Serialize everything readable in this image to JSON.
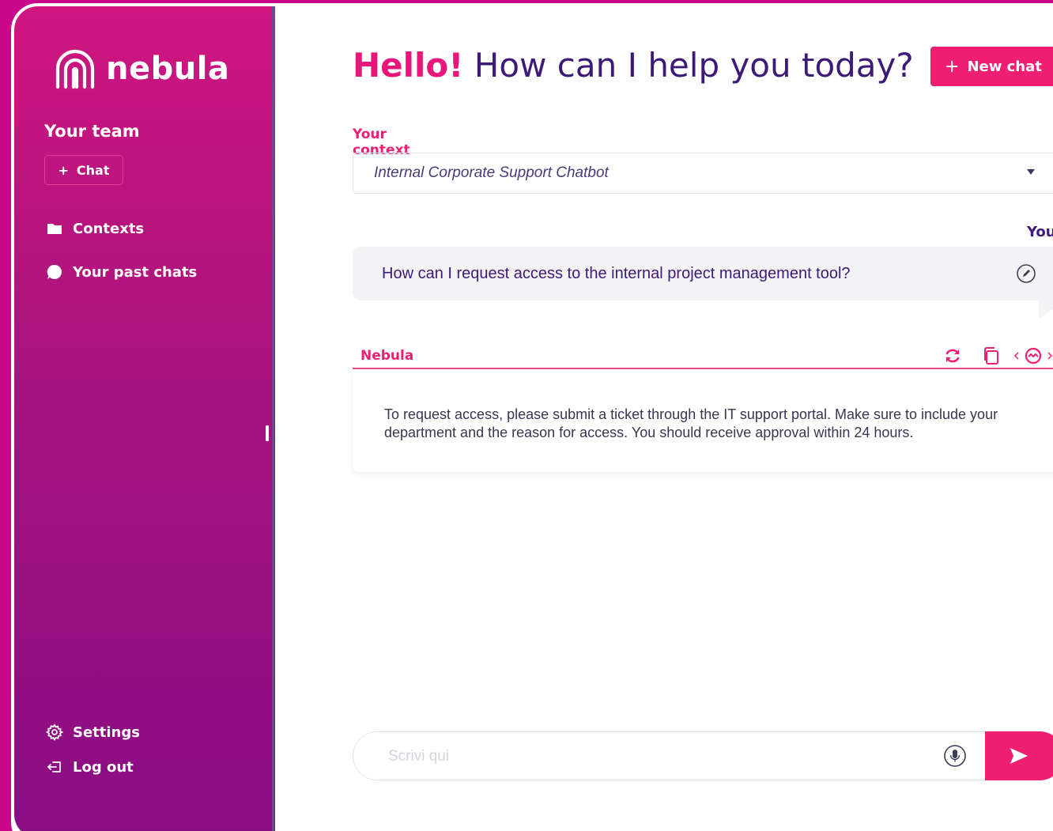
{
  "brand": {
    "name": "nebula"
  },
  "sidebar": {
    "team_title": "Your team",
    "chat_button": "Chat",
    "nav": [
      {
        "label": "Contexts",
        "icon": "folder-icon"
      },
      {
        "label": "Your past chats",
        "icon": "chat-bubble-icon"
      }
    ],
    "footer": [
      {
        "label": "Settings",
        "icon": "gear-icon"
      },
      {
        "label": "Log out",
        "icon": "logout-icon"
      }
    ]
  },
  "header": {
    "greeting": "Hello!",
    "question": "How can I help you today?",
    "new_chat": "New chat"
  },
  "context": {
    "label": "Your context",
    "selected": "Internal Corporate Support Chatbot"
  },
  "conversation": {
    "user_label": "You",
    "user_message": "How can I request access to the internal project management tool?",
    "bot_label": "Nebula",
    "bot_message": "To request access, please submit a ticket through the IT support portal. Make sure to include your department and the reason for access. You should receive approval within 24 hours."
  },
  "composer": {
    "placeholder": "Scrivi qui"
  },
  "colors": {
    "accent": "#ee1f72",
    "brand_purple": "#3d1a78",
    "sidebar_top": "#d0157f",
    "sidebar_bottom": "#8a0c84"
  }
}
